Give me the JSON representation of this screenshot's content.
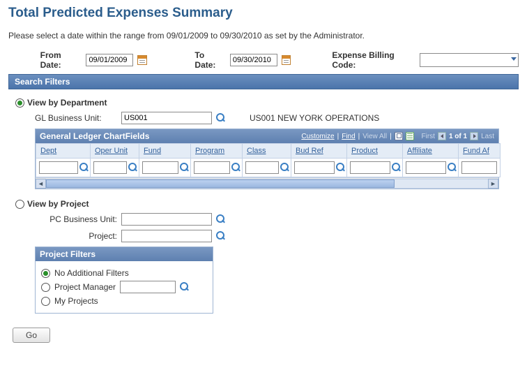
{
  "page_title": "Total Predicted Expenses Summary",
  "instruction": "Please select a date within the range from 09/01/2009 to 09/30/2010 as set by the Administrator.",
  "date_range": {
    "from_label": "From Date:",
    "from_value": "09/01/2009",
    "to_label": "To Date:",
    "to_value": "09/30/2010"
  },
  "billing_code": {
    "label": "Expense Billing Code:",
    "value": ""
  },
  "search_filters_title": "Search Filters",
  "view_by_department": {
    "label": "View by Department",
    "checked": true,
    "gl_bu_label": "GL Business Unit:",
    "gl_bu_value": "US001",
    "gl_bu_desc": "US001 NEW YORK OPERATIONS"
  },
  "chartfields_grid": {
    "title": "General Ledger ChartFields",
    "links": {
      "customize": "Customize",
      "find": "Find",
      "view_all": "View All",
      "first": "First",
      "counter": "1 of 1",
      "last": "Last"
    },
    "columns": [
      "Dept",
      "Oper Unit",
      "Fund",
      "Program",
      "Class",
      "Bud Ref",
      "Product",
      "Affiliate",
      "Fund Af"
    ],
    "row": [
      "",
      "",
      "",
      "",
      "",
      "",
      "",
      "",
      ""
    ]
  },
  "view_by_project": {
    "label": "View by Project",
    "checked": false,
    "pc_bu_label": "PC Business Unit:",
    "pc_bu_value": "",
    "project_label": "Project:",
    "project_value": ""
  },
  "project_filters": {
    "title": "Project Filters",
    "no_additional": {
      "label": "No Additional Filters",
      "checked": true
    },
    "project_manager": {
      "label": "Project Manager",
      "checked": false,
      "value": ""
    },
    "my_projects": {
      "label": "My Projects",
      "checked": false
    }
  },
  "go_button": "Go"
}
